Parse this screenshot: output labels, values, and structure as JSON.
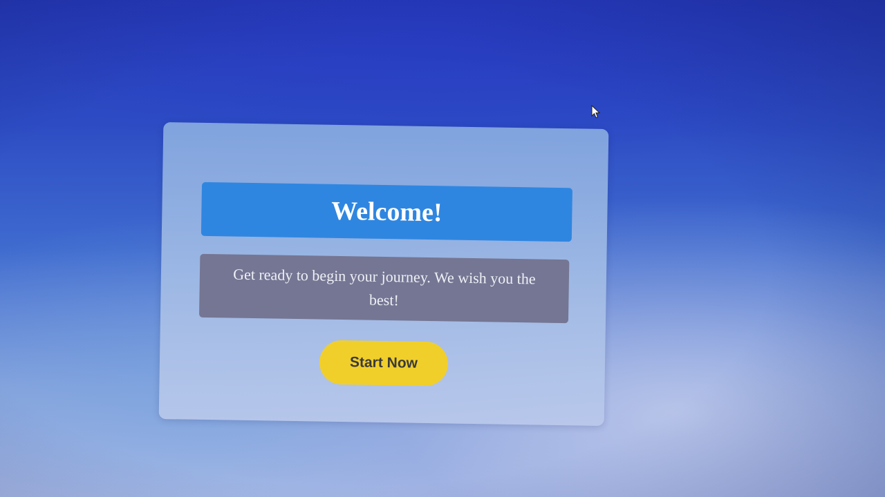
{
  "dialog": {
    "title": "Welcome!",
    "message": "Get ready to begin your journey. We wish you the best!",
    "start_button_label": "Start Now"
  },
  "colors": {
    "title_bar": "#2f86e0",
    "message_box": "#757693",
    "start_button": "#f1cf2a",
    "start_button_text": "#3a3a3a"
  },
  "icons": {
    "cursor": "mouse-pointer-icon"
  }
}
